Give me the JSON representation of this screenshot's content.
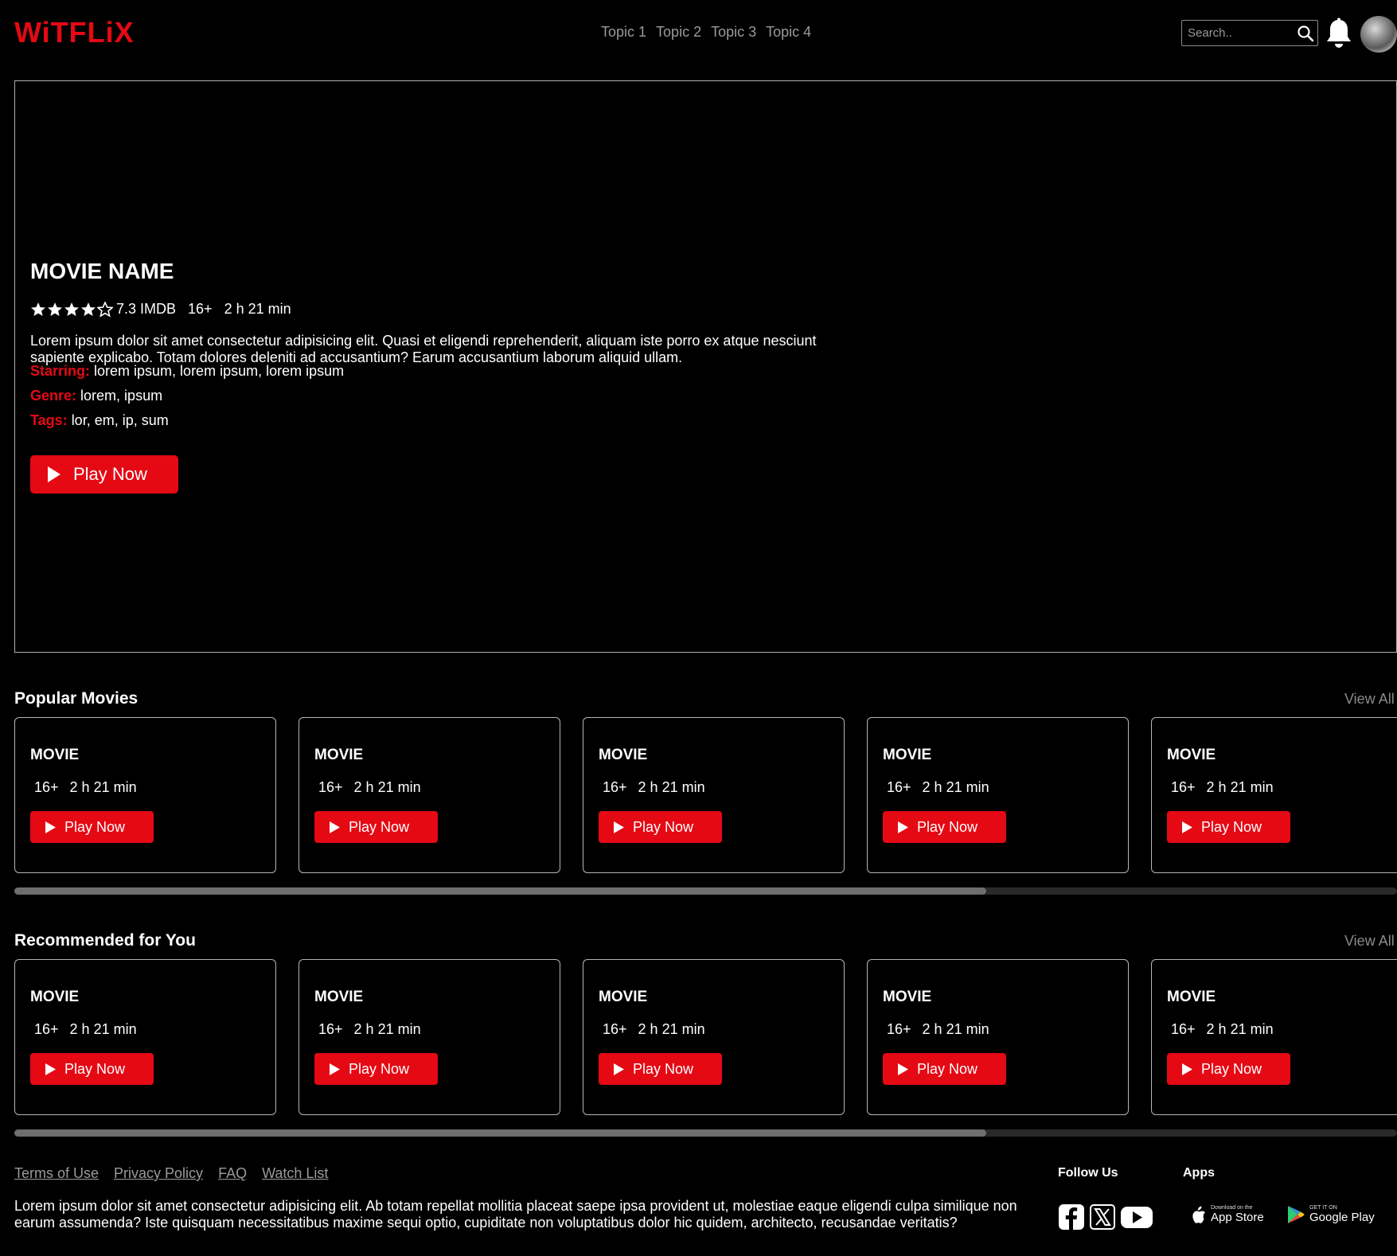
{
  "header": {
    "logo": "WiTFLiX",
    "nav": [
      "Topic 1",
      "Topic 2",
      "Topic 3",
      "Topic 4"
    ],
    "search_placeholder": "Search..",
    "icons": [
      "search-icon",
      "bell-icon",
      "avatar"
    ]
  },
  "hero": {
    "title": "MOVIE NAME",
    "rating_stars": 4,
    "rating_max": 5,
    "imdb": "7.3 IMDB",
    "age": "16+",
    "duration": "2 h 21 min",
    "description": "Lorem ipsum dolor sit amet consectetur adipisicing elit. Quasi et eligendi reprehenderit, aliquam iste porro ex atque nesciunt sapiente explicabo. Totam dolores deleniti ad accusantium? Earum accusantium laborum aliquid ullam.",
    "starring_label": "Starring:",
    "starring": "lorem ipsum, lorem ipsum, lorem ipsum",
    "genre_label": "Genre:",
    "genre": "lorem, ipsum",
    "tags_label": "Tags:",
    "tags": "lor, em, ip, sum",
    "play_label": "Play Now"
  },
  "sections": [
    {
      "title": "Popular Movies",
      "view_all": "View All",
      "scroll_fraction": 0.703,
      "cards": [
        {
          "title": "MOVIE",
          "age": "16+",
          "duration": "2 h 21 min",
          "play": "Play Now"
        },
        {
          "title": "MOVIE",
          "age": "16+",
          "duration": "2 h 21 min",
          "play": "Play Now"
        },
        {
          "title": "MOVIE",
          "age": "16+",
          "duration": "2 h 21 min",
          "play": "Play Now"
        },
        {
          "title": "MOVIE",
          "age": "16+",
          "duration": "2 h 21 min",
          "play": "Play Now"
        },
        {
          "title": "MOVIE",
          "age": "16+",
          "duration": "2 h 21 min",
          "play": "Play Now"
        }
      ]
    },
    {
      "title": "Recommended for You",
      "view_all": "View All",
      "scroll_fraction": 0.703,
      "cards": [
        {
          "title": "MOVIE",
          "age": "16+",
          "duration": "2 h 21 min",
          "play": "Play Now"
        },
        {
          "title": "MOVIE",
          "age": "16+",
          "duration": "2 h 21 min",
          "play": "Play Now"
        },
        {
          "title": "MOVIE",
          "age": "16+",
          "duration": "2 h 21 min",
          "play": "Play Now"
        },
        {
          "title": "MOVIE",
          "age": "16+",
          "duration": "2 h 21 min",
          "play": "Play Now"
        },
        {
          "title": "MOVIE",
          "age": "16+",
          "duration": "2 h 21 min",
          "play": "Play Now"
        }
      ]
    }
  ],
  "footer": {
    "links": [
      "Terms of Use",
      "Privacy Policy",
      "FAQ",
      "Watch List"
    ],
    "text": "Lorem ipsum dolor sit amet consectetur adipisicing elit. Ab totam repellat mollitia placeat saepe ipsa provident ut, molestiae eaque eligendi culpa similique non earum assumenda? Iste quisquam necessitatibus maxime sequi optio, cupiditate non voluptatibus dolor hic quidem, architecto, recusandae veritatis?",
    "follow_title": "Follow Us",
    "apps_title": "Apps",
    "social_icons": [
      "facebook-icon",
      "x-icon",
      "youtube-icon"
    ],
    "app_store_small": "Download on the",
    "app_store_big": "App Store",
    "google_play_small": "GET IT ON",
    "google_play_big": "Google Play"
  },
  "colors": {
    "accent": "#e50914",
    "background": "#000000",
    "muted_text": "#9a9a9a"
  }
}
